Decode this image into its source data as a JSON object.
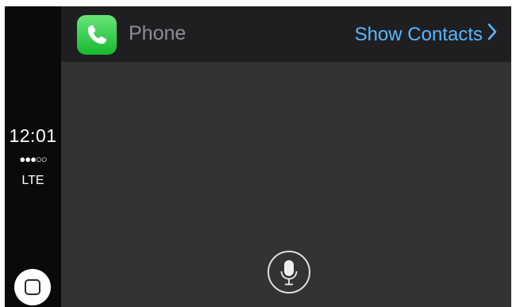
{
  "status": {
    "time": "12:01",
    "signal": "●●●○○",
    "network": "LTE"
  },
  "header": {
    "app_icon": "phone-icon",
    "app_icon_color": "#2fc443",
    "title": "Phone",
    "action_label": "Show Contacts",
    "action_color": "#59b6ff"
  },
  "controls": {
    "home_icon": "home-button-icon",
    "siri_icon": "microphone-icon"
  }
}
